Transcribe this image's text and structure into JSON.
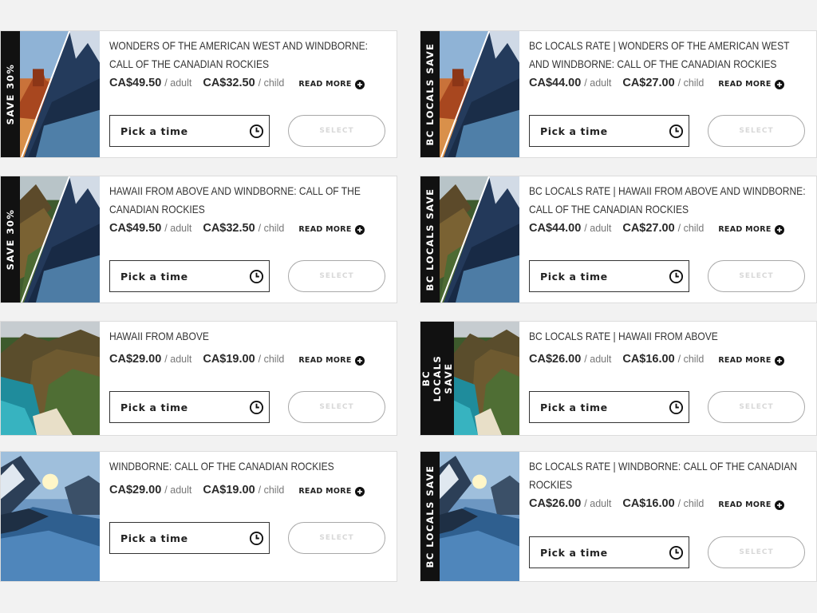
{
  "common": {
    "adult_suffix": "/ adult",
    "child_suffix": "/ child",
    "read_more": "READ MORE",
    "pick_time": "Pick a time",
    "select": "SELECT"
  },
  "cards": [
    {
      "badge": "SAVE 30%",
      "title": "WONDERS OF THE AMERICAN WEST AND WINDBORNE: CALL OF THE CANADIAN ROCKIES",
      "adult_price": "CA$49.50",
      "child_price": "CA$32.50",
      "image": "desert-mountain-split"
    },
    {
      "badge": "BC LOCALS SAVE",
      "title": "BC LOCALS RATE | WONDERS OF THE AMERICAN WEST AND WINDBORNE: CALL OF THE CANADIAN ROCKIES",
      "adult_price": "CA$44.00",
      "child_price": "CA$27.00",
      "image": "desert-mountain-split"
    },
    {
      "badge": "SAVE 30%",
      "title": "HAWAII FROM ABOVE AND WINDBORNE: CALL OF THE CANADIAN ROCKIES",
      "adult_price": "CA$49.50",
      "child_price": "CA$32.50",
      "image": "cliffs-mountain-split"
    },
    {
      "badge": "BC LOCALS SAVE",
      "title": "BC LOCALS RATE | HAWAII FROM ABOVE AND WINDBORNE: CALL OF THE CANADIAN ROCKIES",
      "adult_price": "CA$44.00",
      "child_price": "CA$27.00",
      "image": "cliffs-mountain-split"
    },
    {
      "badge": "",
      "title": "HAWAII FROM ABOVE",
      "adult_price": "CA$29.00",
      "child_price": "CA$19.00",
      "image": "hawaii-coast"
    },
    {
      "badge": "BC LOCALS\nSAVE",
      "title": "BC LOCALS RATE | HAWAII FROM ABOVE",
      "adult_price": "CA$26.00",
      "child_price": "CA$16.00",
      "image": "hawaii-coast"
    },
    {
      "badge": "",
      "title": "WINDBORNE: CALL OF THE CANADIAN ROCKIES",
      "adult_price": "CA$29.00",
      "child_price": "CA$19.00",
      "image": "rockies-lake"
    },
    {
      "badge": "BC LOCALS SAVE",
      "title": "BC LOCALS RATE | WINDBORNE: CALL OF THE CANADIAN ROCKIES",
      "adult_price": "CA$26.00",
      "child_price": "CA$16.00",
      "image": "rockies-lake"
    }
  ]
}
